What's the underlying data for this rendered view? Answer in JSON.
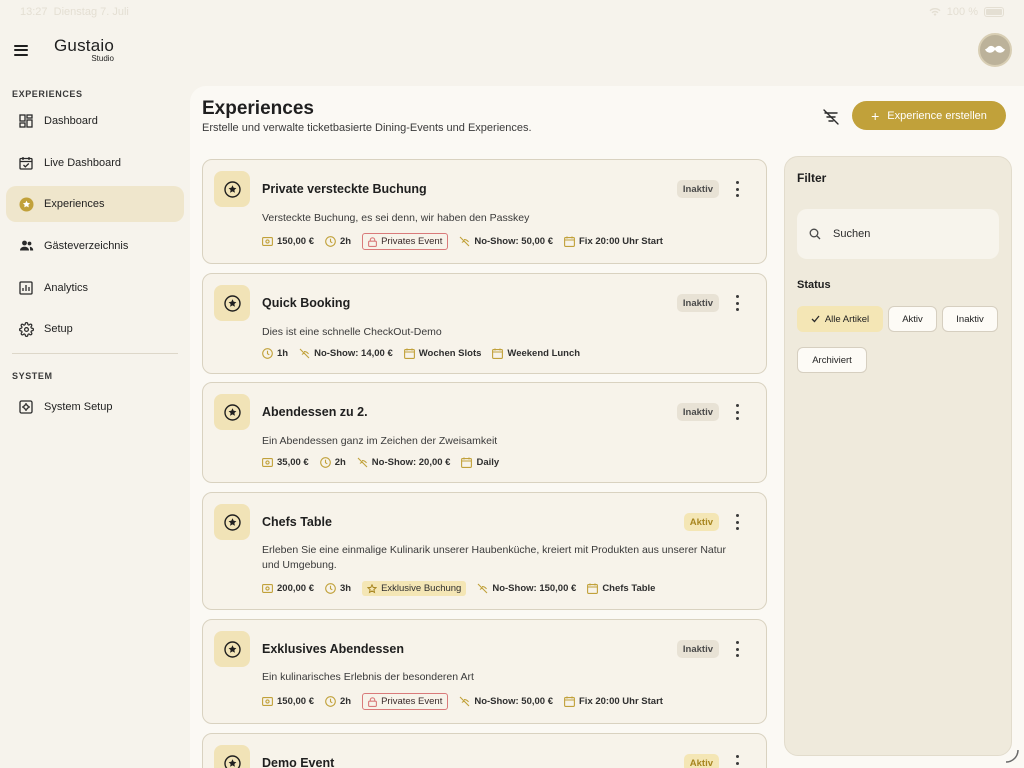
{
  "statusbar": {
    "time": "13:27",
    "date": "Dienstag 7. Juli",
    "battery": "100 %"
  },
  "brand": {
    "name": "Gustaio",
    "sub": "Studio"
  },
  "sidebar": {
    "section_experiences": "EXPERIENCES",
    "items": [
      {
        "label": "Dashboard",
        "icon": "dashboard-icon"
      },
      {
        "label": "Live Dashboard",
        "icon": "calendar-check-icon"
      },
      {
        "label": "Experiences",
        "icon": "star-circle-icon",
        "active": true
      },
      {
        "label": "Gästeverzeichnis",
        "icon": "users-icon"
      },
      {
        "label": "Analytics",
        "icon": "analytics-icon"
      },
      {
        "label": "Setup",
        "icon": "gear-icon"
      }
    ],
    "section_system": "SYSTEM",
    "system_items": [
      {
        "label": "System Setup",
        "icon": "system-gear-icon"
      }
    ]
  },
  "header": {
    "title": "Experiences",
    "subtitle": "Erstelle und verwalte ticketbasierte Dining-Events und Experiences.",
    "create_label": "Experience erstellen"
  },
  "experiences": [
    {
      "title": "Private versteckte Buchung",
      "status": "Inaktiv",
      "description": "Versteckte Buchung, es sei denn, wir haben den Passkey",
      "price": "150,00 €",
      "duration": "2h",
      "tag": "Privates Event",
      "noshow": "No-Show: 50,00 €",
      "schedule": "Fix 20:00 Uhr Start"
    },
    {
      "title": "Quick Booking",
      "status": "Inaktiv",
      "description": "Dies ist eine schnelle CheckOut-Demo",
      "duration": "1h",
      "noshow": "No-Show: 14,00 €",
      "schedule": "Wochen Slots",
      "schedule2": "Weekend Lunch"
    },
    {
      "title": "Abendessen zu 2.",
      "status": "Inaktiv",
      "description": "Ein Abendessen ganz im Zeichen der Zweisamkeit",
      "price": "35,00 €",
      "duration": "2h",
      "noshow": "No-Show: 20,00 €",
      "schedule": "Daily"
    },
    {
      "title": "Chefs Table",
      "status": "Aktiv",
      "description": "Erleben Sie eine einmalige Kulinarik unserer Haubenküche, kreiert mit Produkten aus unserer Natur und Umgebung.",
      "price": "200,00 €",
      "duration": "3h",
      "tag": "Exklusive Buchung",
      "noshow": "No-Show: 150,00 €",
      "schedule": "Chefs Table"
    },
    {
      "title": "Exklusives Abendessen",
      "status": "Inaktiv",
      "description": "Ein kulinarisches Erlebnis der besonderen Art",
      "price": "150,00 €",
      "duration": "2h",
      "tag": "Privates Event",
      "noshow": "No-Show: 50,00 €",
      "schedule": "Fix 20:00 Uhr Start"
    },
    {
      "title": "Demo Event",
      "status": "Aktiv"
    }
  ],
  "filter": {
    "title": "Filter",
    "search_placeholder": "Suchen",
    "status_label": "Status",
    "chips": {
      "all": "Alle Artikel",
      "active": "Aktiv",
      "inactive": "Inaktiv",
      "archived": "Archiviert"
    }
  },
  "colors": {
    "accent": "#c1a13a",
    "active_bg": "#f4e6b5",
    "sidebar_active": "#efe6cc",
    "private_tag": "#d97a7a"
  }
}
